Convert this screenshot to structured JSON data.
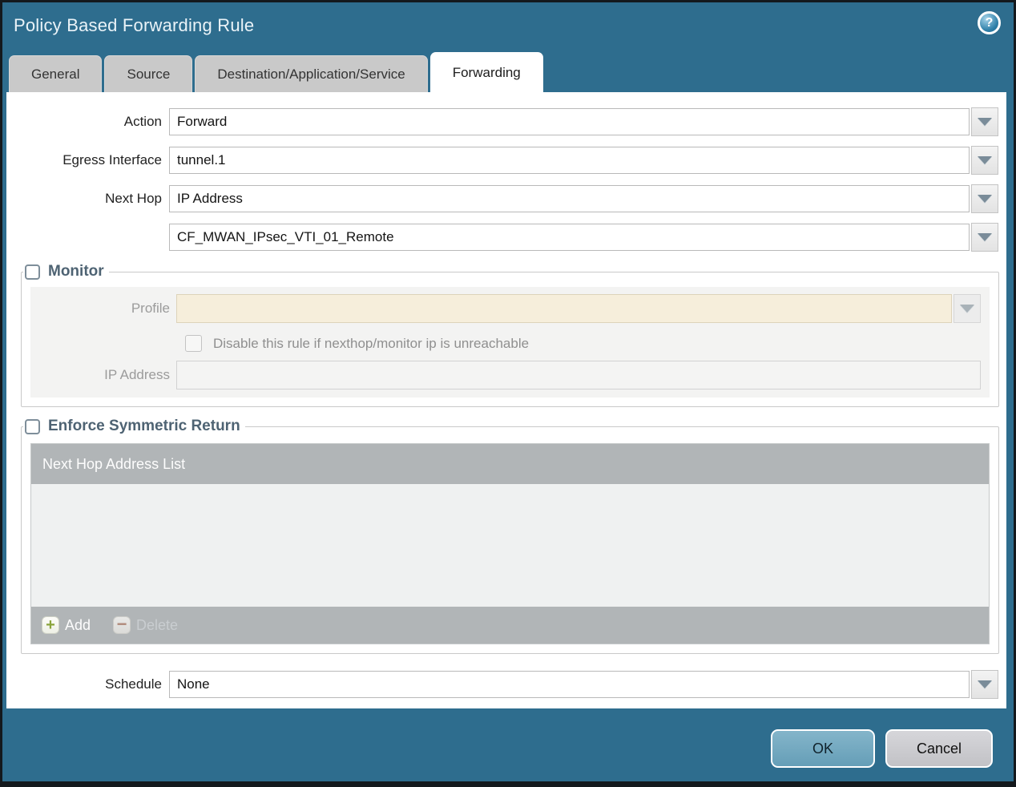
{
  "dialog": {
    "title": "Policy Based Forwarding Rule",
    "help_glyph": "?"
  },
  "tabs": [
    {
      "label": "General"
    },
    {
      "label": "Source"
    },
    {
      "label": "Destination/Application/Service"
    },
    {
      "label": "Forwarding"
    }
  ],
  "form": {
    "action": {
      "label": "Action",
      "value": "Forward"
    },
    "egress_interface": {
      "label": "Egress Interface",
      "value": "tunnel.1"
    },
    "next_hop": {
      "label": "Next Hop",
      "value": "IP Address"
    },
    "next_hop_address": {
      "value": "CF_MWAN_IPsec_VTI_01_Remote"
    },
    "schedule": {
      "label": "Schedule",
      "value": "None"
    }
  },
  "monitor": {
    "legend": "Monitor",
    "checked": false,
    "profile": {
      "label": "Profile",
      "value": ""
    },
    "disable_rule": {
      "label": "Disable this rule if nexthop/monitor ip is unreachable",
      "checked": false
    },
    "ip_address": {
      "label": "IP Address",
      "value": ""
    }
  },
  "enforce_symmetric_return": {
    "legend": "Enforce Symmetric Return",
    "checked": false,
    "table": {
      "header": "Next Hop Address List",
      "rows": []
    },
    "add_label": "Add",
    "delete_label": "Delete",
    "add_glyph": "+",
    "delete_glyph": "−"
  },
  "footer": {
    "ok_label": "OK",
    "cancel_label": "Cancel"
  },
  "colors": {
    "titlebar": "#2e6d8e",
    "table_gray": "#b1b5b7",
    "ok_button": "#72a9c0",
    "disabled_field": "#f6eedb",
    "accent_green": "#8aa43c"
  }
}
